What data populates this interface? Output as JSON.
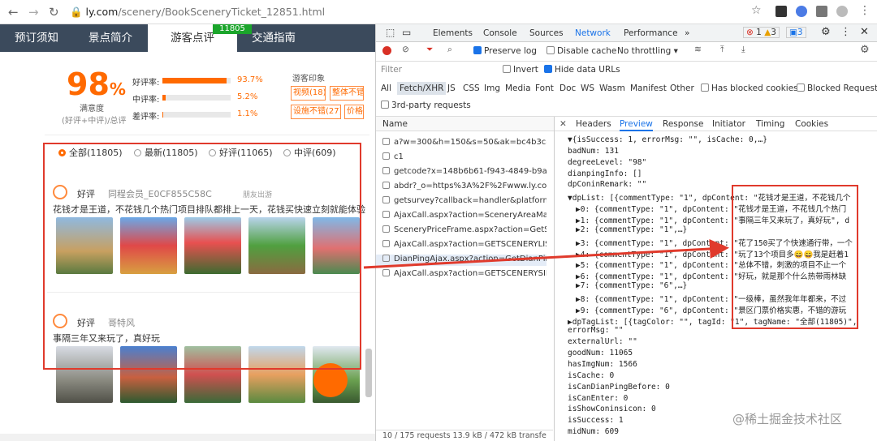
{
  "browser": {
    "url_host": "ly.com",
    "url_path": "/scenery/BookSceneryTicket_12851.html"
  },
  "page": {
    "tabs": [
      "预订须知",
      "景点简介",
      "游客点评",
      "交通指南"
    ],
    "count_badge": "11805",
    "score": "98",
    "score_unit": "%",
    "score_label": "满意度",
    "score_sub": "(好评+中评)/总评",
    "ratings": [
      {
        "label": "好评率:",
        "pct": "93.7%",
        "value": 0.937
      },
      {
        "label": "中评率:",
        "pct": "5.2%",
        "value": 0.052
      },
      {
        "label": "差评率:",
        "pct": "1.1%",
        "value": 0.011
      }
    ],
    "impression_title": "游客印象",
    "impression_tags": [
      "视频(18)",
      "整体不错",
      "设施不错(27)",
      "价格"
    ],
    "filters": [
      "全部(11805)",
      "最新(11805)",
      "好评(11065)",
      "中评(609)"
    ],
    "reviews": [
      {
        "level": "好评",
        "user": "同程会员_E0CF855C58C",
        "tag": "朋友出游",
        "text": "花钱才是王道，不花钱几个热门项目排队都排上一天，花钱买快速立刻就能体验"
      },
      {
        "level": "好评",
        "user": "哥特风",
        "tag": "",
        "text": "事隔三年又来玩了，真好玩"
      }
    ]
  },
  "devtools": {
    "tabs": [
      "Elements",
      "Console",
      "Sources",
      "Network",
      "Performance",
      "»"
    ],
    "active_tab": "Network",
    "badges": [
      "1",
      "3",
      "3"
    ],
    "toolbar": {
      "preserve_log": "Preserve log",
      "disable_cache": "Disable cache",
      "throttle": "No throttling"
    },
    "filter_placeholder": "Filter",
    "invert": "Invert",
    "hide_data": "Hide data URLs",
    "types": [
      "All",
      "Fetch/XHR",
      "JS",
      "CSS",
      "Img",
      "Media",
      "Font",
      "Doc",
      "WS",
      "Wasm",
      "Manifest",
      "Other"
    ],
    "blocked_cookies": "Has blocked cookies",
    "blocked_requests": "Blocked Requests",
    "third_party": "3rd-party requests",
    "name_header": "Name",
    "requests": [
      "a?w=300&h=150&s=50&ak=bc4b3ca6...",
      "c1",
      "getcode?x=148b6b61-f943-4849-b9af-...",
      "abdr?_o=https%3A%2F%2Fwww.ly.com",
      "getsurvey?callback=handler&platform...",
      "AjaxCall.aspx?action=SceneryAreaMark...",
      "SceneryPriceFrame.aspx?action=GetSce...",
      "AjaxCall.aspx?action=GETSCENERYLIST...",
      "DianPingAjax.aspx?action=GetDianPing...",
      "AjaxCall.aspx?action=GETSCENERYSIMI..."
    ],
    "footer": "10 / 175 requests   13.9 kB / 472 kB transfe",
    "preview_tabs": [
      "Headers",
      "Preview",
      "Response",
      "Initiator",
      "Timing",
      "Cookies"
    ],
    "json_lines": [
      "▼{isSuccess: 1, errorMsg: \"\", isCache: 0,…}",
      "badNum: 131",
      "degreeLevel: \"98\"",
      "dianpingInfo: []",
      "dpConinRemark: \"\"",
      "▼dpList: [{commentType: \"1\", dpContent: \"花钱才是王道，不花钱几个",
      "▶0: {commentType: \"1\", dpContent: \"花钱才是王道，不花钱几个热门",
      "▶1: {commentType: \"1\", dpContent: \"事隔三年又来玩了，真好玩\", d",
      "▶2: {commentType: \"1\",…}",
      "▶3: {commentType: \"1\", dpContent: \"花了150买了个快速通行带，一个",
      "▶4: {commentType: \"1\", dpContent: \"玩了13个项目多😄😄我是赶着1",
      "▶5: {commentType: \"1\", dpContent: \"总体不错，刺激的项目不止一个",
      "▶6: {commentType: \"1\", dpContent: \"好玩，就是那个什么热带雨林缺",
      "▶7: {commentType: \"6\",…}",
      "▶8: {commentType: \"1\", dpContent: \"一级棒，虽然我年年都来，不过",
      "▶9: {commentType: \"6\", dpContent: \"景区门票价格实惠，不错的游玩",
      "▶dpTagList: [{tagColor: \"\", tagId: \"1\", tagName: \"全部(11805)\",",
      "errorMsg: \"\"",
      "externalUrl: \"\"",
      "goodNum: 11065",
      "hasImgNum: 1566",
      "isCache: 0",
      "isCanDianPingBefore: 0",
      "isCanEnter: 0",
      "isShowConinsicon: 0",
      "isSuccess: 1",
      "midNum: 609"
    ]
  },
  "watermark": "@稀土掘金技术社区",
  "colors": {
    "accent": "#ff6a00",
    "annotation": "#e03a2c",
    "tab_bg": "#3b4a5c"
  }
}
